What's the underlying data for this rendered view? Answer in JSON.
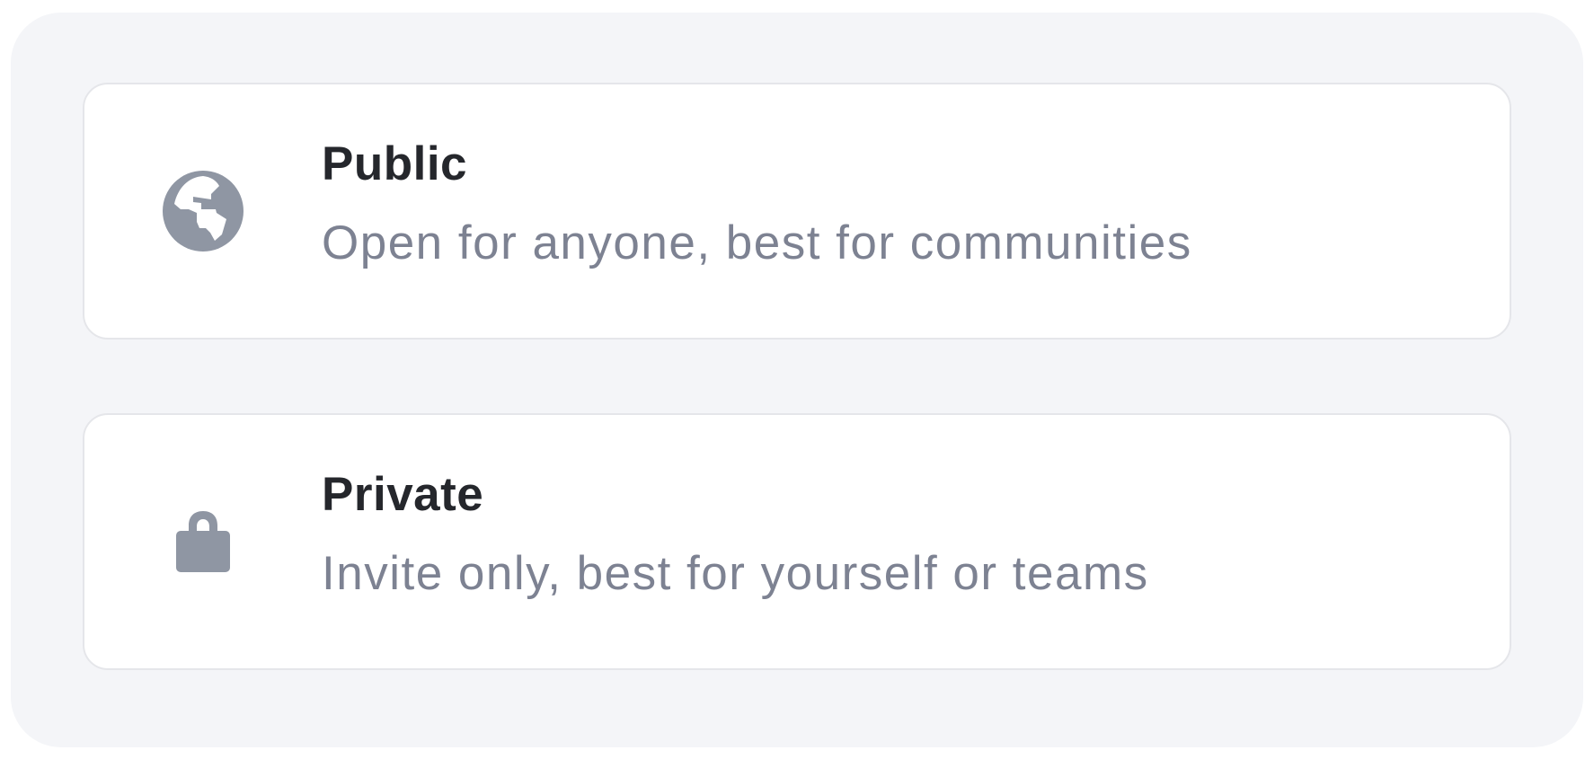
{
  "visibility_options": [
    {
      "title": "Public",
      "description": "Open for anyone, best for communities",
      "icon": "globe-icon"
    },
    {
      "title": "Private",
      "description": "Invite only, best for yourself or teams",
      "icon": "lock-icon"
    }
  ],
  "colors": {
    "background": "#f4f5f8",
    "card": "#ffffff",
    "card_border": "#e5e6ea",
    "title": "#25272c",
    "description": "#7d8292",
    "icon": "#8f96a3"
  }
}
